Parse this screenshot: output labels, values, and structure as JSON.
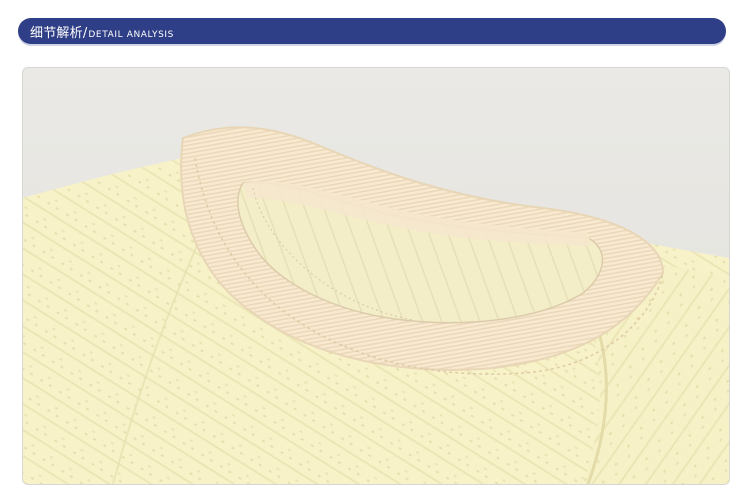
{
  "header": {
    "title_cn": "细节解析",
    "separator": "/",
    "title_en": "DETAIL ANALYSIS",
    "bar_color": "#2f3f87"
  },
  "photo": {
    "subject": "garment-collar-detail",
    "garment_color": "#f7f2c8",
    "rib_collar_color": "#f8e8cf",
    "background_color": "#e8e7e3"
  }
}
